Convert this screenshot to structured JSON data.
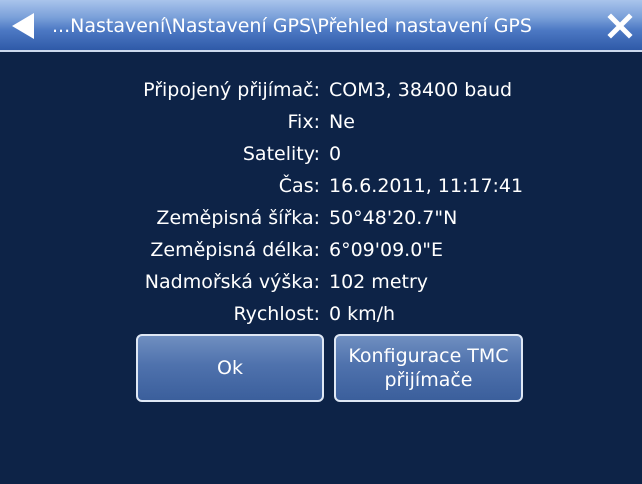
{
  "header": {
    "title": "...Nastavení\\Nastavení GPS\\Přehled nastavení GPS"
  },
  "gps_overview": [
    {
      "label": "Připojený přijímač:",
      "value": "COM3, 38400 baud"
    },
    {
      "label": "Fix:",
      "value": "Ne"
    },
    {
      "label": "Satelity:",
      "value": "0"
    },
    {
      "label": "Čas:",
      "value": "16.6.2011, 11:17:41"
    },
    {
      "label": "Zeměpisná šířka:",
      "value": "50°48'20.7\"N"
    },
    {
      "label": "Zeměpisná délka:",
      "value": "6°09'09.0\"E"
    },
    {
      "label": "Nadmořská výška:",
      "value": "102 metry"
    },
    {
      "label": "Rychlost:",
      "value": "0 km/h"
    }
  ],
  "buttons": {
    "ok_label": "Ok",
    "tmc_label_line1": "Konfigurace TMC",
    "tmc_label_line2": "přijímače"
  },
  "colors": {
    "background": "#0d2347",
    "titlebar": "#5b83c9",
    "button": "#4f72ad",
    "text": "#ffffff"
  },
  "icons": {
    "back": "back-arrow-icon",
    "close": "close-icon"
  }
}
